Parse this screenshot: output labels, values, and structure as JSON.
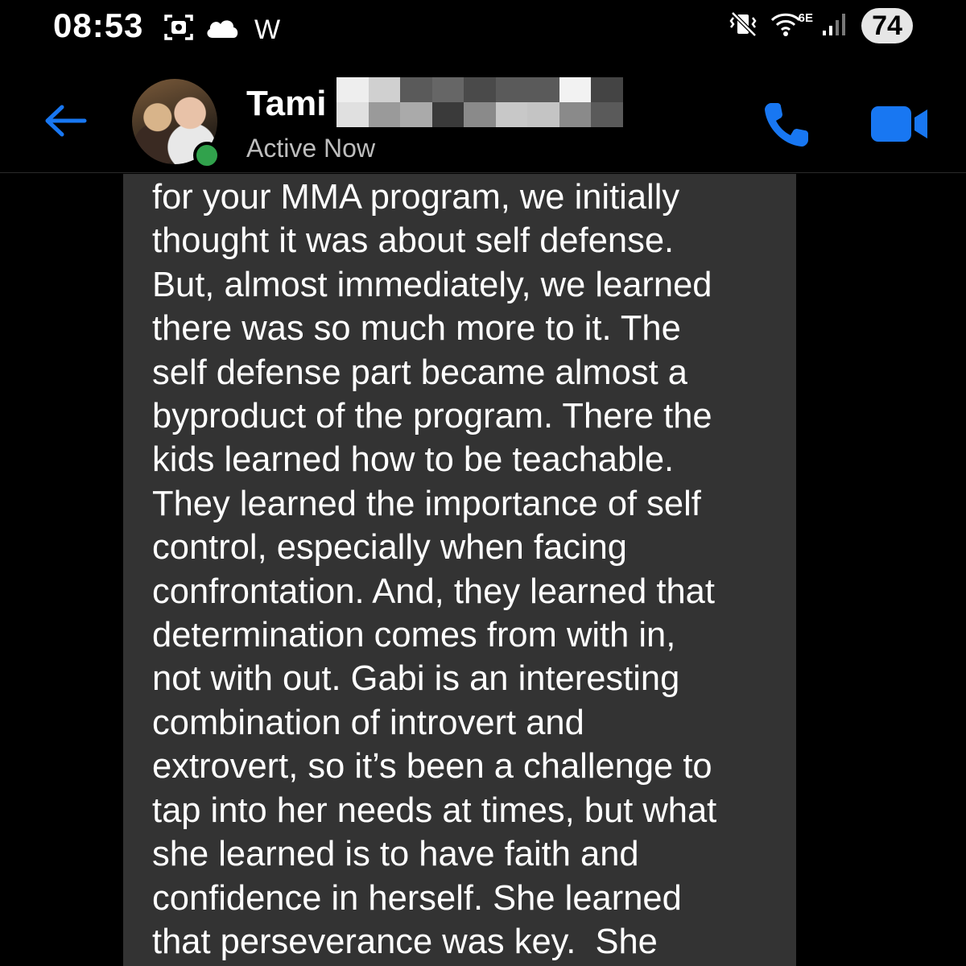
{
  "status_bar": {
    "time": "08:53",
    "left_letter": "W",
    "network_label": "6E",
    "battery": "74",
    "icons": [
      "screen-record-icon",
      "cloud-icon",
      "vibrate-mute-icon",
      "wifi-icon",
      "signal-icon",
      "battery-icon"
    ]
  },
  "header": {
    "contact_name": "Tami",
    "status": "Active Now",
    "icons": [
      "back-arrow-icon",
      "phone-icon",
      "video-camera-icon"
    ]
  },
  "colors": {
    "accent": "#1877f2",
    "background": "#000000",
    "bubble": "#333333",
    "online": "#31a24c",
    "secondary_text": "#bdbdbd"
  },
  "message": {
    "lines": [
      "for your MMA program, we initially",
      "thought it was about self defense.",
      "But, almost immediately, we learned",
      "there was so much more to it. The",
      "self defense part became almost a",
      "byproduct of the program. There the",
      "kids learned how to be teachable.",
      "They learned the importance of self",
      "control, especially when facing",
      "confrontation. And, they learned that",
      "determination comes from with in,",
      "not with out. Gabi is an interesting",
      "combination of introvert and",
      "extrovert, so it’s been a challenge to",
      "tap into her needs at times, but what",
      "she learned is to have faith and",
      "confidence in herself. She learned",
      "that perseverance was key.  She"
    ]
  }
}
